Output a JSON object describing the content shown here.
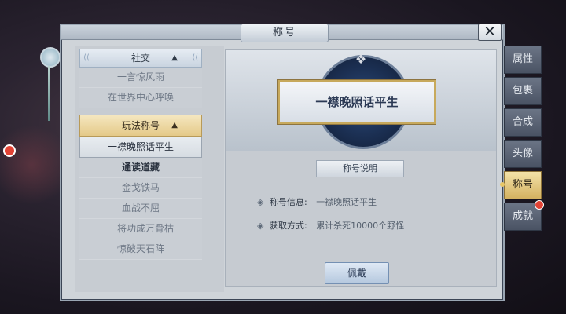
{
  "window": {
    "title": "称号",
    "close_label": "✕"
  },
  "list": {
    "category_social": "社交",
    "social_items": [
      "一言惊风雨",
      "在世界中心呼唤"
    ],
    "category_play": "玩法称号",
    "play_items": [
      {
        "label": "一襟晚照话平生",
        "state": "selected"
      },
      {
        "label": "通读道藏",
        "state": "owned"
      },
      {
        "label": "金戈铁马",
        "state": "locked"
      },
      {
        "label": "血战不屈",
        "state": "locked"
      },
      {
        "label": "一将功成万骨枯",
        "state": "locked"
      },
      {
        "label": "惊破天石阵",
        "state": "locked"
      }
    ]
  },
  "detail": {
    "title_display": "一襟晚照话平生",
    "section_heading": "称号说明",
    "info_label": "称号信息:",
    "info_value": "一襟晚照话平生",
    "method_label": "获取方式:",
    "method_value": "累计杀死10000个野怪",
    "wear_button": "佩戴"
  },
  "tabs": [
    {
      "label": "属性",
      "active": false,
      "badge": false
    },
    {
      "label": "包裹",
      "active": false,
      "badge": false
    },
    {
      "label": "合成",
      "active": false,
      "badge": false
    },
    {
      "label": "头像",
      "active": false,
      "badge": false
    },
    {
      "label": "称号",
      "active": true,
      "badge": false
    },
    {
      "label": "成就",
      "active": false,
      "badge": true
    }
  ],
  "colors": {
    "accent_gold": "#d4b261",
    "badge_red": "#e24335",
    "card_text": "#2c3a55"
  }
}
